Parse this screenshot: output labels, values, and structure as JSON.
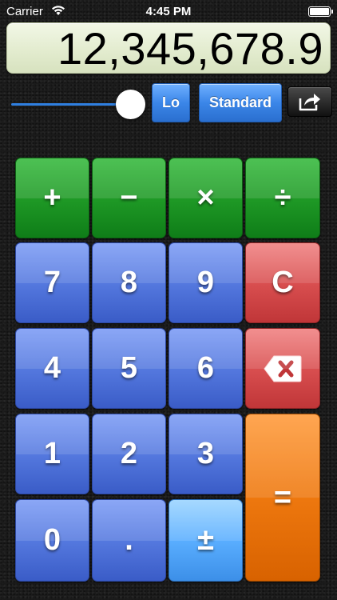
{
  "status_bar": {
    "carrier": "Carrier",
    "time": "4:45 PM",
    "wifi_icon": "wifi-icon",
    "battery_icon": "battery-icon"
  },
  "display": {
    "value": "12,345,678.9"
  },
  "controls": {
    "precision_slider": {
      "value": 1.0,
      "icon": "slider-knob"
    },
    "lo_label": "Lo",
    "mode_label": "Standard",
    "share_icon": "share-icon"
  },
  "keypad": {
    "add": "+",
    "subtract": "−",
    "multiply": "×",
    "divide": "÷",
    "seven": "7",
    "eight": "8",
    "nine": "9",
    "clear": "C",
    "four": "4",
    "five": "5",
    "six": "6",
    "backspace_icon": "backspace-icon",
    "one": "1",
    "two": "2",
    "three": "3",
    "equals": "=",
    "zero": "0",
    "decimal": ".",
    "plus_minus": "±"
  },
  "colors": {
    "operator": "#1f9a26",
    "digit": "#5579df",
    "clear": "#d94f50",
    "equals": "#f07a10",
    "display_bg": "#e3eccf"
  }
}
